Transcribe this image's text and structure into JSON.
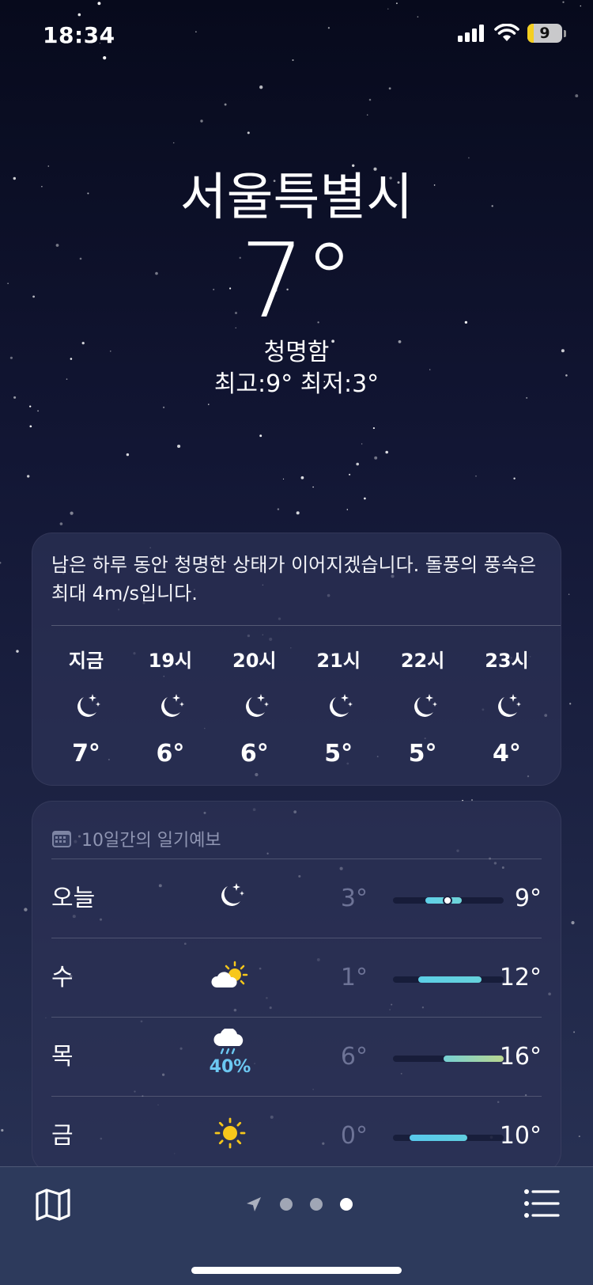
{
  "status": {
    "time": "18:34",
    "battery": "9"
  },
  "location": {
    "city": "서울특별시",
    "temperature": "7°",
    "condition": "청명함",
    "hi_lo": "최고:9°  최저:3°"
  },
  "hourly": {
    "summary": "남은 하루 동안 청명한 상태가 이어지겠습니다. 돌풍의 풍속은 최대 4m/s입니다.",
    "hours": [
      {
        "label": "지금",
        "icon": "moon-stars-icon",
        "temp": "7°"
      },
      {
        "label": "19시",
        "icon": "moon-stars-icon",
        "temp": "6°"
      },
      {
        "label": "20시",
        "icon": "moon-stars-icon",
        "temp": "6°"
      },
      {
        "label": "21시",
        "icon": "moon-stars-icon",
        "temp": "5°"
      },
      {
        "label": "22시",
        "icon": "moon-stars-icon",
        "temp": "5°"
      },
      {
        "label": "23시",
        "icon": "moon-stars-icon",
        "temp": "4°"
      }
    ]
  },
  "daily": {
    "title": "10일간의 일기예보",
    "days": [
      {
        "name": "오늘",
        "icon": "moon-stars-icon",
        "precip": "",
        "low": "3°",
        "high": "9°",
        "range_start": 0.29,
        "range_end": 0.62,
        "current": 0.49,
        "colors": [
          "#5fd0e8",
          "#6fd4d8"
        ]
      },
      {
        "name": "수",
        "icon": "partly-cloudy-sun-icon",
        "precip": "",
        "low": "1°",
        "high": "12°",
        "range_start": 0.23,
        "range_end": 0.8,
        "current": null,
        "colors": [
          "#5ccfe6",
          "#66d2dc"
        ]
      },
      {
        "name": "목",
        "icon": "cloud-rain-icon",
        "precip": "40%",
        "low": "6°",
        "high": "16°",
        "range_start": 0.46,
        "range_end": 1.0,
        "current": null,
        "colors": [
          "#76d0d4",
          "#b9d68f"
        ]
      },
      {
        "name": "금",
        "icon": "sun-icon",
        "precip": "",
        "low": "0°",
        "high": "10°",
        "range_start": 0.15,
        "range_end": 0.67,
        "current": null,
        "colors": [
          "#58c8ec",
          "#60cfe0"
        ]
      }
    ]
  },
  "pager": {
    "page_count": 3,
    "active_index": 2
  }
}
